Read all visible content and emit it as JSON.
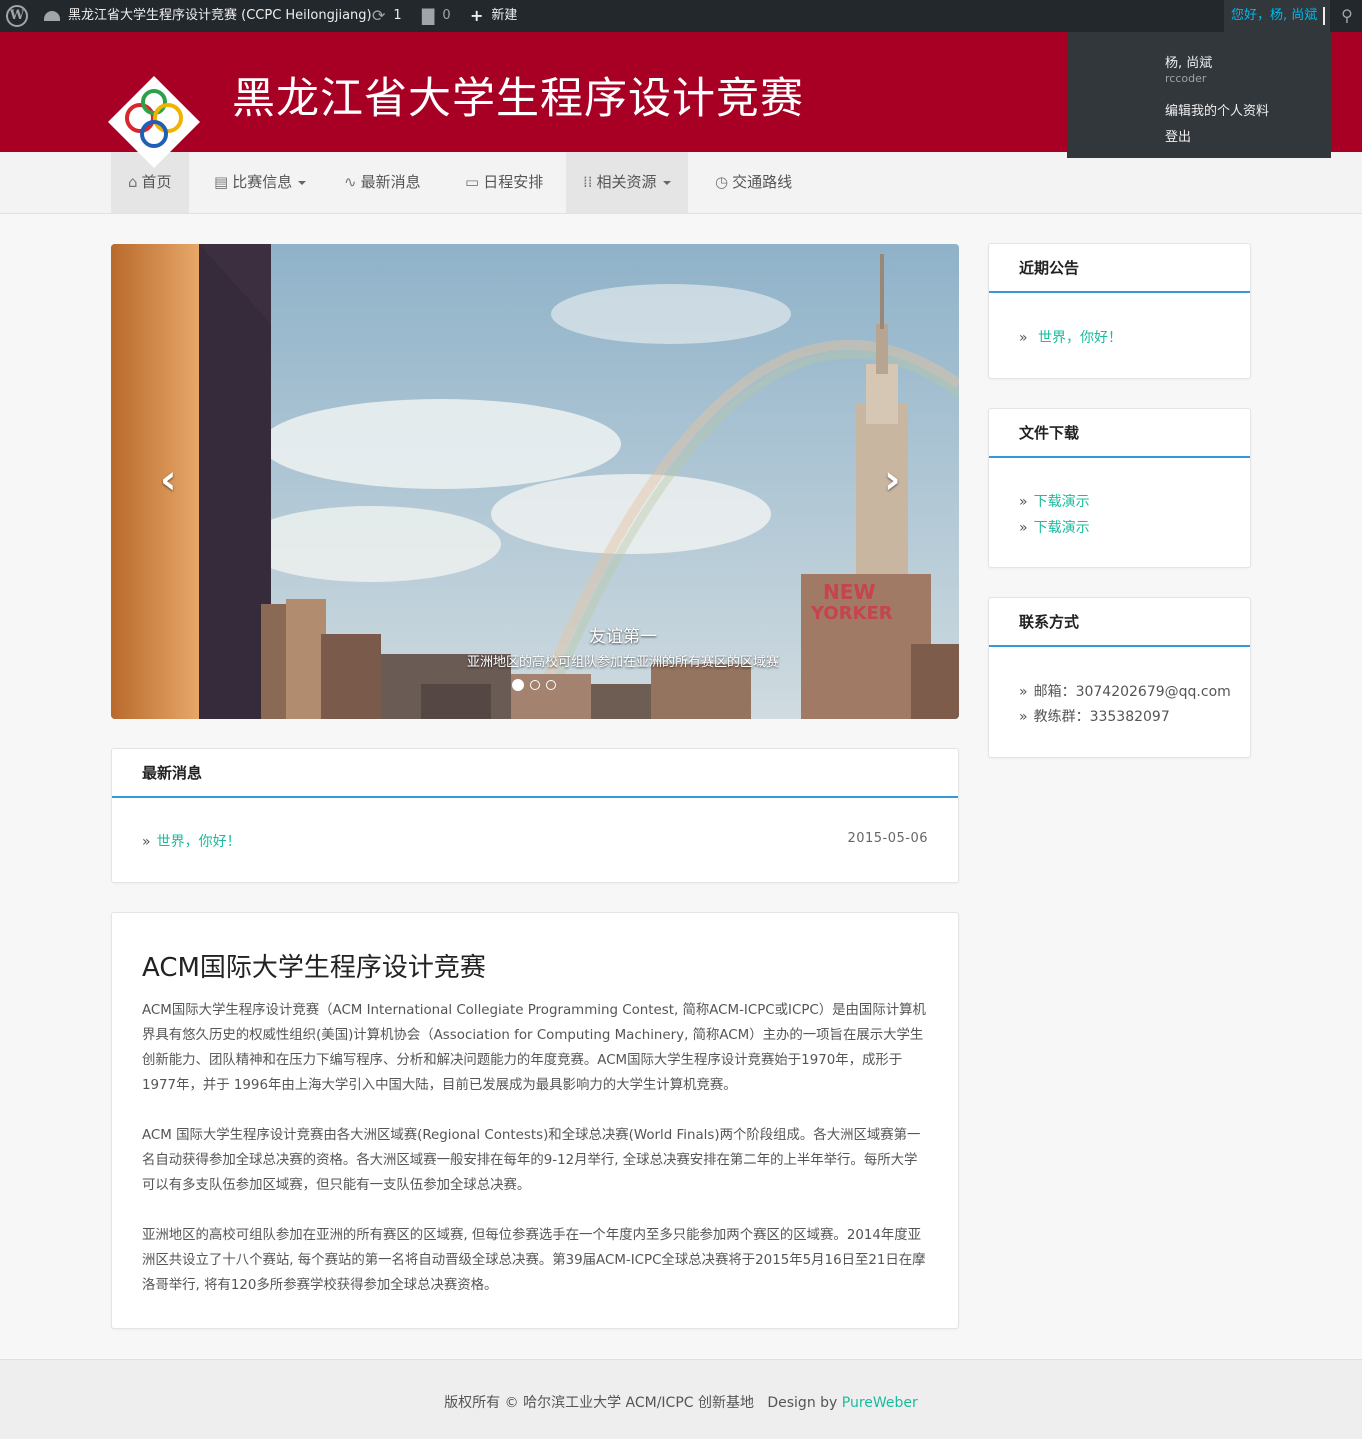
{
  "admin_bar": {
    "wp_logo": "W",
    "site_name": "黑龙江省大学生程序设计竞赛 (CCPC Heilongjiang)",
    "updates_count": "1",
    "comments_count": "0",
    "new_label": "新建",
    "greeting": "您好，杨, 尚斌",
    "icons": {
      "updates": "refresh-icon",
      "comments": "comment-icon",
      "new": "plus-icon",
      "search": "search-icon"
    }
  },
  "account_menu": {
    "display_name": "杨, 尚斌",
    "username": "rccoder",
    "edit_profile": "编辑我的个人资料",
    "logout": "登出"
  },
  "header": {
    "title": "黑龙江省大学生程序设计竞赛",
    "brand_color": "#a80024"
  },
  "nav": {
    "items": [
      {
        "label": "首页",
        "icon": "home-icon",
        "dropdown": false
      },
      {
        "label": "比赛信息",
        "icon": "clipboard-icon",
        "dropdown": true
      },
      {
        "label": "最新消息",
        "icon": "pulse-icon",
        "dropdown": false
      },
      {
        "label": "日程安排",
        "icon": "calendar-icon",
        "dropdown": false
      },
      {
        "label": "相关资源",
        "icon": "grid-icon",
        "dropdown": true
      },
      {
        "label": "交通路线",
        "icon": "compass-icon",
        "dropdown": false
      }
    ]
  },
  "carousel": {
    "caption_title": "友谊第一",
    "caption_text": "亚洲地区的高校可组队参加在亚洲的所有赛区的区域赛",
    "slide_count": 3,
    "active_slide": 1,
    "sign_text_1": "NEW",
    "sign_text_2": "YORKER"
  },
  "news": {
    "heading": "最新消息",
    "items": [
      {
        "title": "世界，你好！",
        "date": "2015-05-06"
      }
    ]
  },
  "article": {
    "title": "ACM国际大学生程序设计竞赛",
    "paragraphs": [
      "ACM国际大学生程序设计竞赛（ACM International Collegiate Programming Contest, 简称ACM-ICPC或ICPC）是由国际计算机界具有悠久历史的权威性组织(美国)计算机协会（Association for Computing Machinery, 简称ACM）主办的一项旨在展示大学生创新能力、团队精神和在压力下编写程序、分析和解决问题能力的年度竞赛。ACM国际大学生程序设计竞赛始于1970年，成形于1977年，并于 1996年由上海大学引入中国大陆，目前已发展成为最具影响力的大学生计算机竞赛。",
      "ACM 国际大学生程序设计竞赛由各大洲区域赛(Regional Contests)和全球总决赛(World Finals)两个阶段组成。各大洲区域赛第一名自动获得参加全球总决赛的资格。各大洲区域赛一般安排在每年的9-12月举行, 全球总决赛安排在第二年的上半年举行。每所大学可以有多支队伍参加区域赛，但只能有一支队伍参加全球总决赛。",
      "亚洲地区的高校可组队参加在亚洲的所有赛区的区域赛, 但每位参赛选手在一个年度内至多只能参加两个赛区的区域赛。2014年度亚洲区共设立了十八个赛站, 每个赛站的第一名将自动晋级全球总决赛。第39届ACM-ICPC全球总决赛将于2015年5月16日至21日在摩洛哥举行, 将有120多所参赛学校获得参加全球总决赛资格。"
    ]
  },
  "sidebar": {
    "announcements": {
      "heading": "近期公告",
      "items": [
        "世界，你好！"
      ]
    },
    "downloads": {
      "heading": "文件下载",
      "items": [
        "下载演示",
        "下载演示"
      ]
    },
    "contact": {
      "heading": "联系方式",
      "items": [
        "邮箱：3074202679@qq.com",
        "教练群：335382097"
      ]
    }
  },
  "footer": {
    "copyright": "版权所有 © 哈尔滨工业大学 ACM/ICPC 创新基地",
    "design_by": "Design by",
    "designer": "PureWeber"
  },
  "colors": {
    "link": "#1abc9c",
    "panel_rule": "#3498db",
    "admin_bar": "#23282d"
  }
}
